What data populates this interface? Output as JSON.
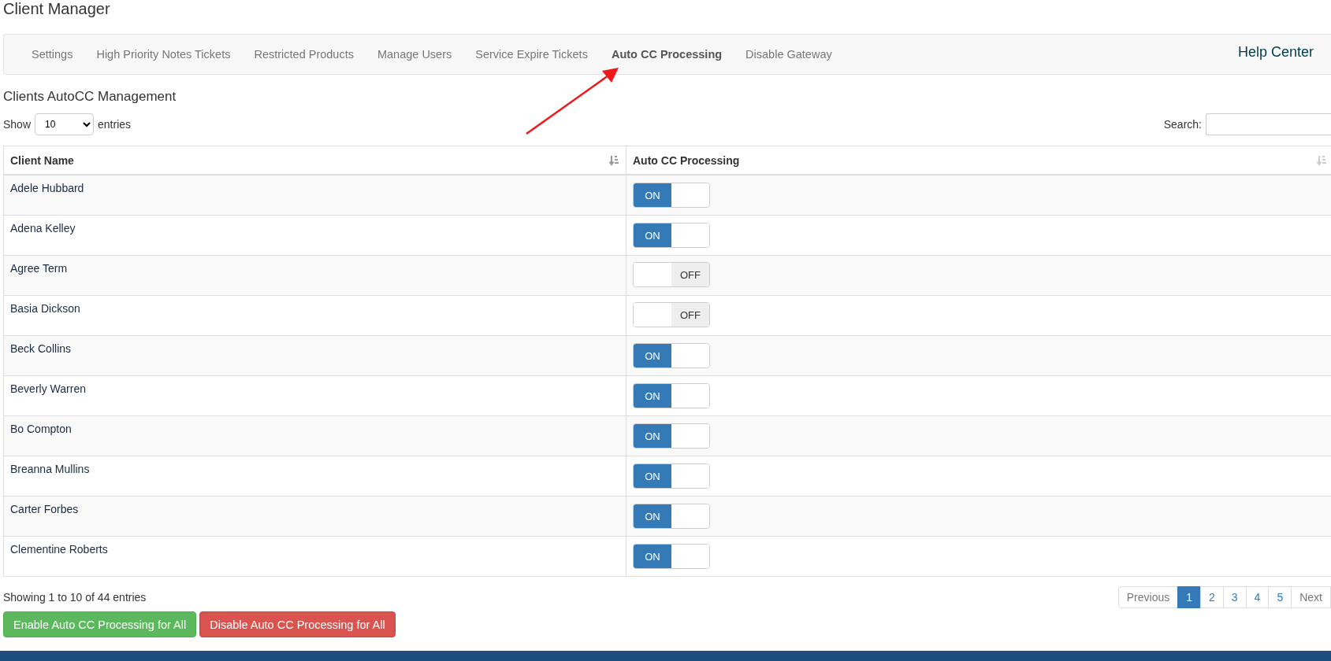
{
  "page_title": "Client Manager",
  "nav": {
    "tabs": [
      {
        "label": "Settings",
        "selected": false
      },
      {
        "label": "High Priority Notes Tickets",
        "selected": false
      },
      {
        "label": "Restricted Products",
        "selected": false
      },
      {
        "label": "Manage Users",
        "selected": false
      },
      {
        "label": "Service Expire Tickets",
        "selected": false
      },
      {
        "label": "Auto CC Processing",
        "selected": true
      },
      {
        "label": "Disable Gateway",
        "selected": false
      }
    ],
    "help_link": "Help Center"
  },
  "section_title": "Clients AutoCC Management",
  "length_control": {
    "before": "Show",
    "value": "10",
    "after": "entries"
  },
  "search": {
    "label": "Search:"
  },
  "table": {
    "columns": [
      "Client Name",
      "Auto CC Processing"
    ],
    "rows": [
      {
        "client": "Adele Hubbard",
        "on": true,
        "toggle_label": "ON"
      },
      {
        "client": "Adena Kelley",
        "on": true,
        "toggle_label": "ON"
      },
      {
        "client": "Agree Term",
        "on": false,
        "toggle_label": "OFF"
      },
      {
        "client": "Basia Dickson",
        "on": false,
        "toggle_label": "OFF"
      },
      {
        "client": "Beck Collins",
        "on": true,
        "toggle_label": "ON"
      },
      {
        "client": "Beverly Warren",
        "on": true,
        "toggle_label": "ON"
      },
      {
        "client": "Bo Compton",
        "on": true,
        "toggle_label": "ON"
      },
      {
        "client": "Breanna Mullins",
        "on": true,
        "toggle_label": "ON"
      },
      {
        "client": "Carter Forbes",
        "on": true,
        "toggle_label": "ON"
      },
      {
        "client": "Clementine Roberts",
        "on": true,
        "toggle_label": "ON"
      }
    ]
  },
  "info": "Showing 1 to 10 of 44 entries",
  "pagination": [
    {
      "label": "Previous",
      "selected": false,
      "kind": "nav"
    },
    {
      "label": "1",
      "selected": true,
      "kind": "page"
    },
    {
      "label": "2",
      "selected": false,
      "kind": "page"
    },
    {
      "label": "3",
      "selected": false,
      "kind": "page"
    },
    {
      "label": "4",
      "selected": false,
      "kind": "page"
    },
    {
      "label": "5",
      "selected": false,
      "kind": "page"
    },
    {
      "label": "Next",
      "selected": false,
      "kind": "nav"
    }
  ],
  "actions": [
    {
      "label": "Enable Auto CC Processing for All",
      "kind": "success"
    },
    {
      "label": "Disable Auto CC Processing for All",
      "kind": "danger"
    }
  ]
}
